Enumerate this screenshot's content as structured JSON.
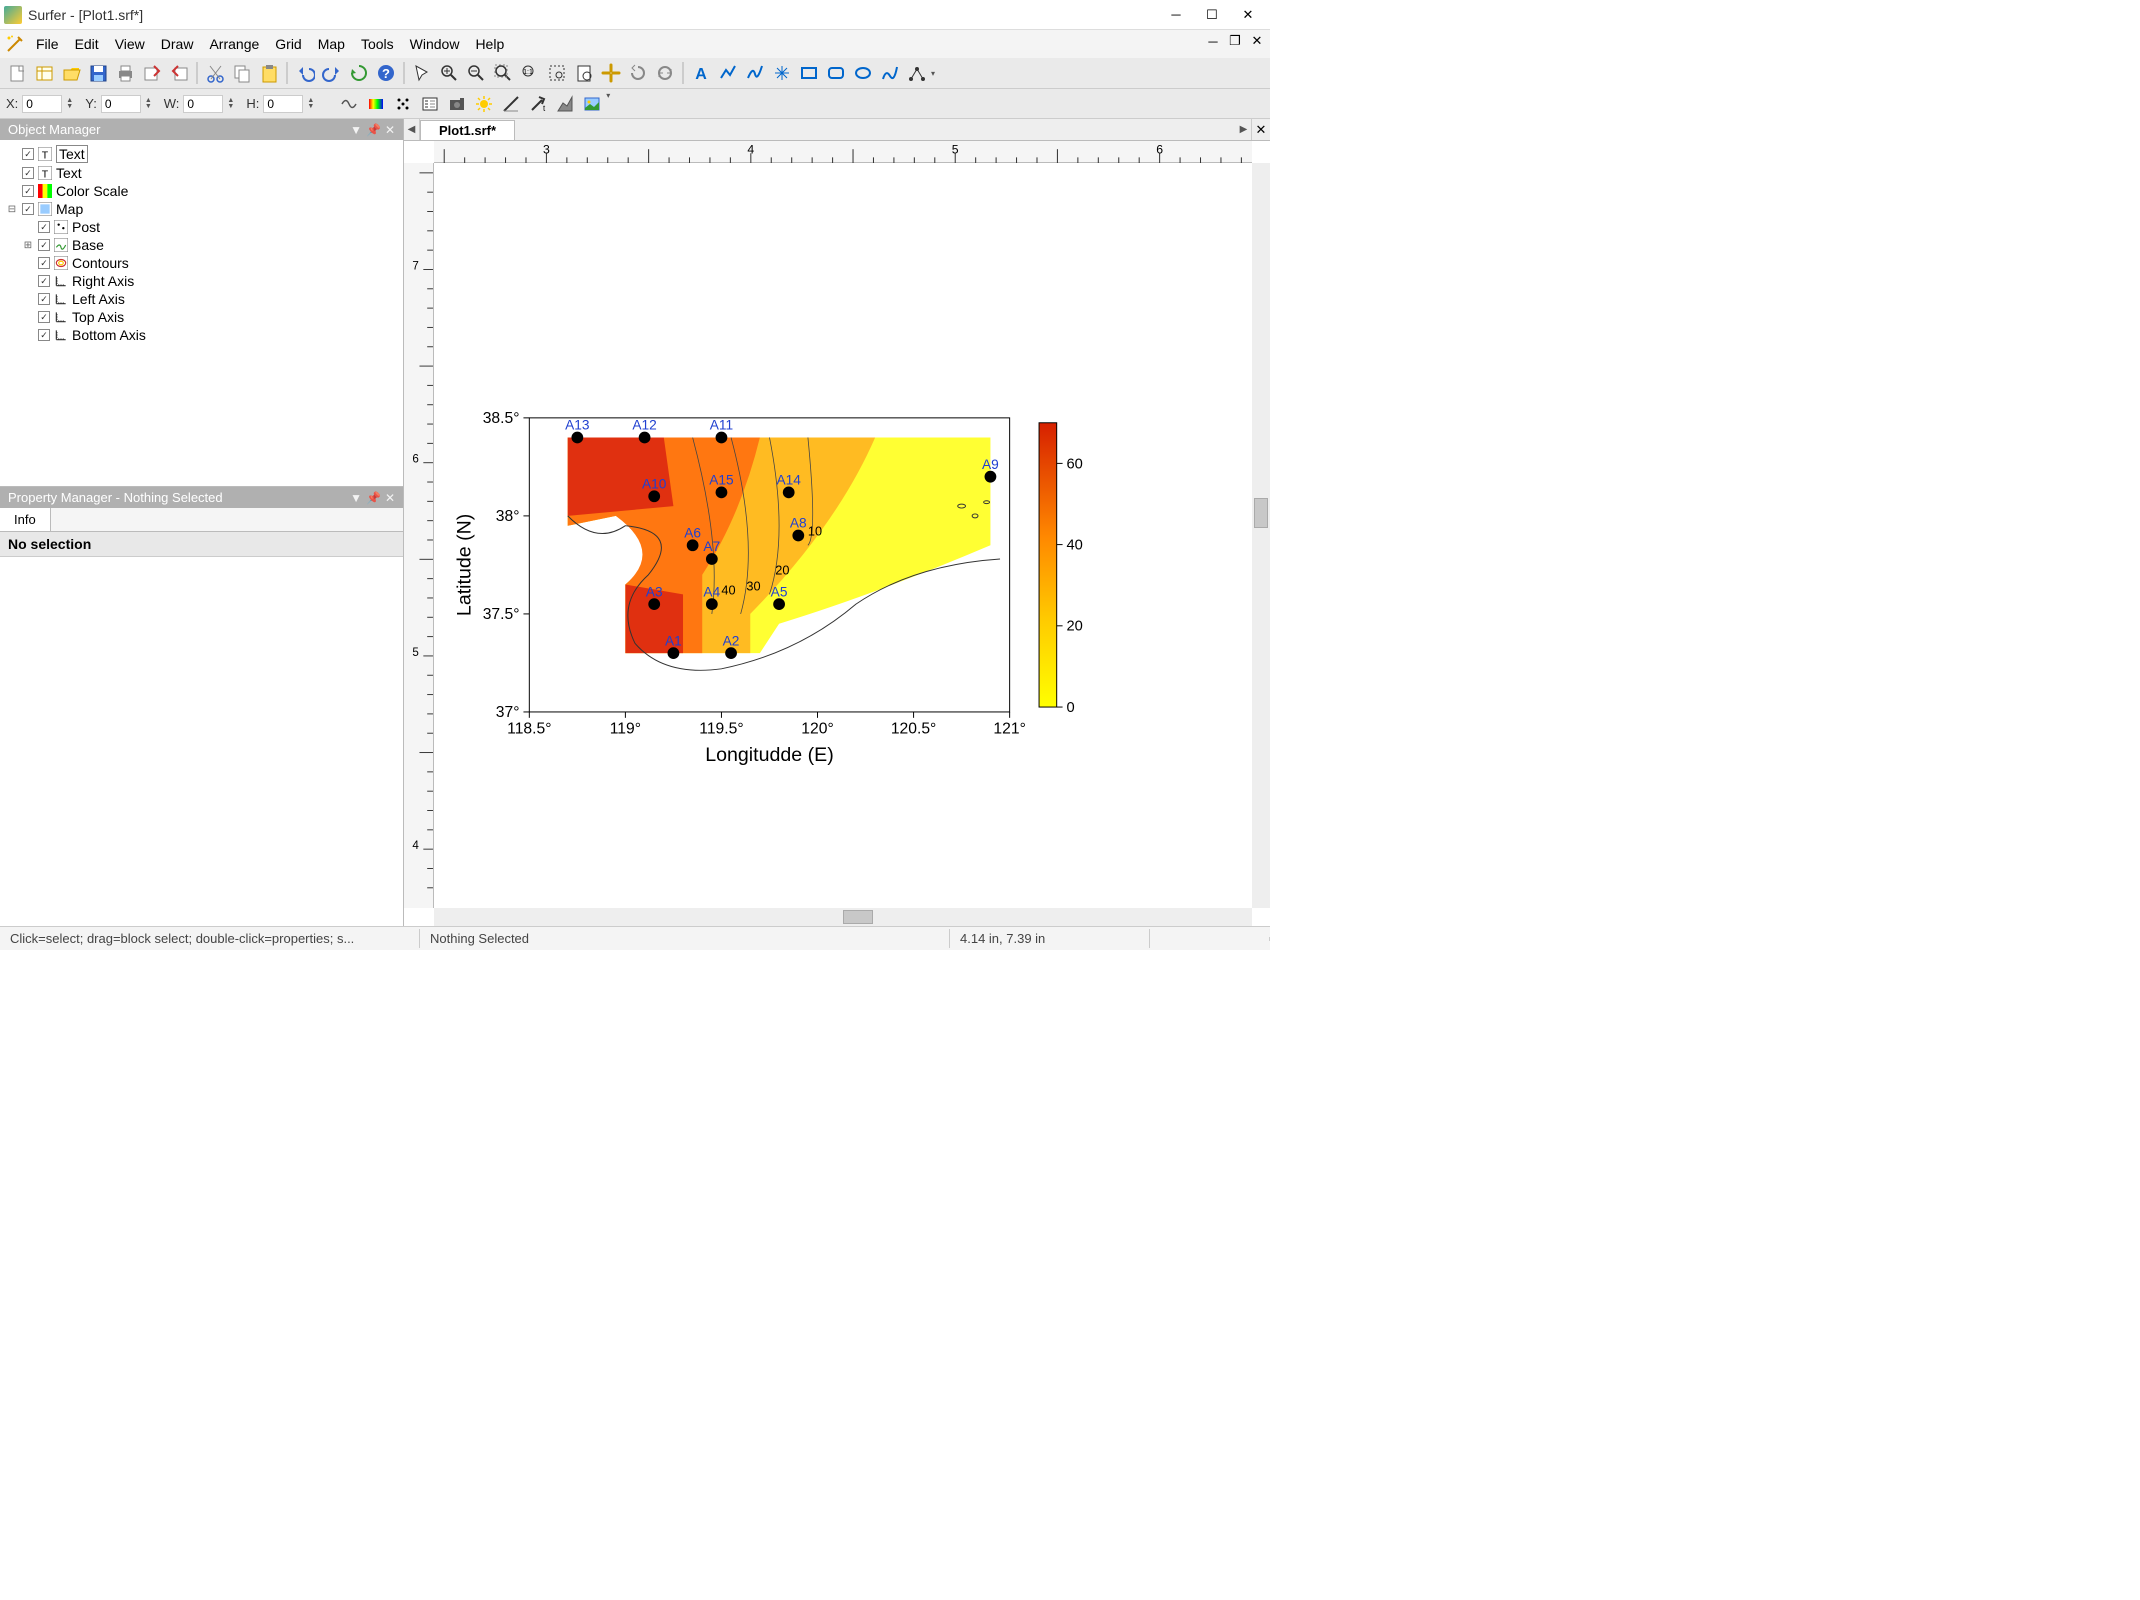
{
  "window": {
    "title": "Surfer - [Plot1.srf*]"
  },
  "menus": [
    "File",
    "Edit",
    "View",
    "Draw",
    "Arrange",
    "Grid",
    "Map",
    "Tools",
    "Window",
    "Help"
  ],
  "coords": {
    "x_label": "X:",
    "x": "0",
    "y_label": "Y:",
    "y": "0",
    "w_label": "W:",
    "w": "0",
    "h_label": "H:",
    "h": "0"
  },
  "object_manager": {
    "title": "Object Manager",
    "items": [
      {
        "label": "Text",
        "indent": 0,
        "selected": true,
        "type": "T"
      },
      {
        "label": "Text",
        "indent": 0,
        "type": "T"
      },
      {
        "label": "Color Scale",
        "indent": 0,
        "type": "scale"
      },
      {
        "label": "Map",
        "indent": 0,
        "type": "map",
        "expandable": true,
        "expanded": true
      },
      {
        "label": "Post",
        "indent": 1,
        "type": "post"
      },
      {
        "label": "Base",
        "indent": 1,
        "type": "base",
        "expandable": true
      },
      {
        "label": "Contours",
        "indent": 1,
        "type": "contour"
      },
      {
        "label": "Right Axis",
        "indent": 1,
        "type": "axis"
      },
      {
        "label": "Left Axis",
        "indent": 1,
        "type": "axis"
      },
      {
        "label": "Top Axis",
        "indent": 1,
        "type": "axis"
      },
      {
        "label": "Bottom Axis",
        "indent": 1,
        "type": "axis"
      }
    ]
  },
  "property_manager": {
    "title": "Property Manager - Nothing Selected",
    "tab": "Info",
    "msg": "No selection"
  },
  "document": {
    "tab": "Plot1.srf*"
  },
  "statusbar": {
    "hint": "Click=select; drag=block select; double-click=properties; s...",
    "sel": "Nothing Selected",
    "coords": "4.14 in, 7.39 in"
  },
  "ruler_h_labels": [
    "3",
    "4",
    "5",
    "6"
  ],
  "ruler_v_labels": [
    "7",
    "6",
    "5",
    "4"
  ],
  "chart_data": {
    "type": "contour_map",
    "title_x": "Longitudde (E)",
    "title_y": "Latitude (N)",
    "x_axis": {
      "min": 118.5,
      "max": 121,
      "ticks": [
        "118.5°",
        "119°",
        "119.5°",
        "120°",
        "120.5°",
        "121°"
      ]
    },
    "y_axis": {
      "min": 37,
      "max": 38.5,
      "ticks": [
        "37°",
        "37.5°",
        "38°",
        "38.5°"
      ]
    },
    "contour_labels": [
      10,
      20,
      30,
      40
    ],
    "colorbar": {
      "min": 0,
      "max": 70,
      "ticks": [
        0,
        20,
        40,
        60
      ]
    },
    "stations": [
      {
        "id": "A1",
        "lon": 119.25,
        "lat": 37.3
      },
      {
        "id": "A2",
        "lon": 119.55,
        "lat": 37.3
      },
      {
        "id": "A3",
        "lon": 119.15,
        "lat": 37.55
      },
      {
        "id": "A4",
        "lon": 119.45,
        "lat": 37.55
      },
      {
        "id": "A5",
        "lon": 119.8,
        "lat": 37.55
      },
      {
        "id": "A6",
        "lon": 119.35,
        "lat": 37.85
      },
      {
        "id": "A7",
        "lon": 119.45,
        "lat": 37.78
      },
      {
        "id": "A8",
        "lon": 119.9,
        "lat": 37.9
      },
      {
        "id": "A9",
        "lon": 120.9,
        "lat": 38.2
      },
      {
        "id": "A10",
        "lon": 119.15,
        "lat": 38.1
      },
      {
        "id": "A11",
        "lon": 119.5,
        "lat": 38.4
      },
      {
        "id": "A12",
        "lon": 119.1,
        "lat": 38.4
      },
      {
        "id": "A13",
        "lon": 118.75,
        "lat": 38.4
      },
      {
        "id": "A14",
        "lon": 119.85,
        "lat": 38.12
      },
      {
        "id": "A15",
        "lon": 119.5,
        "lat": 38.12
      }
    ]
  },
  "toolbar1_icons": [
    "new",
    "wks",
    "open",
    "save",
    "print",
    "export",
    "import",
    "sep",
    "cut",
    "copy",
    "paste",
    "sep",
    "undo",
    "redo",
    "cycle",
    "help",
    "sep",
    "arrow",
    "zoom-in",
    "zoom-out",
    "zoom-rect",
    "zoom-actual",
    "zoom-sel",
    "zoom-page",
    "pan",
    "rotate",
    "refresh",
    "sep",
    "text",
    "polyline",
    "spline",
    "symbol",
    "rect",
    "roundrect",
    "ellipse",
    "freehand",
    "reshape"
  ],
  "toolbar2_icons": [
    "freeform",
    "rainbow",
    "dots",
    "legend",
    "camera",
    "sun",
    "slope",
    "vector",
    "shaded",
    "image"
  ]
}
